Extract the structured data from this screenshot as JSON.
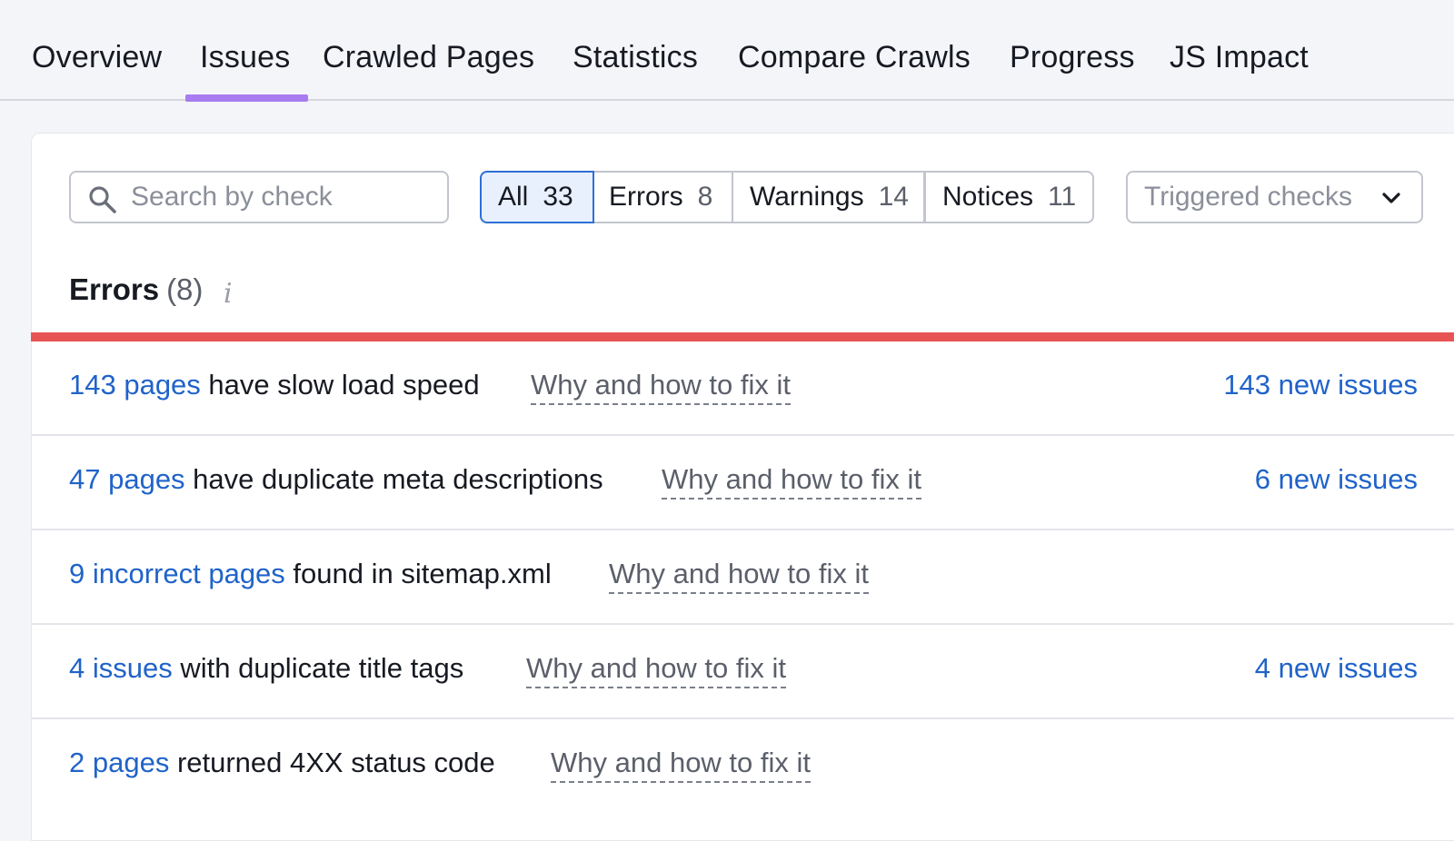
{
  "tabs": [
    {
      "label": "Overview"
    },
    {
      "label": "Issues"
    },
    {
      "label": "Crawled Pages"
    },
    {
      "label": "Statistics"
    },
    {
      "label": "Compare Crawls"
    },
    {
      "label": "Progress"
    },
    {
      "label": "JS Impact"
    }
  ],
  "active_tab": "Issues",
  "accent_color": "#a87cf0",
  "search": {
    "placeholder": "Search by check",
    "value": ""
  },
  "filters": [
    {
      "label": "All",
      "count": "33"
    },
    {
      "label": "Errors",
      "count": "8"
    },
    {
      "label": "Warnings",
      "count": "14"
    },
    {
      "label": "Notices",
      "count": "11"
    }
  ],
  "active_filter": "All",
  "triggered_select": {
    "label": "Triggered checks"
  },
  "section": {
    "title": "Errors",
    "count": "(8)",
    "color": "#e75454"
  },
  "issues": [
    {
      "link": "143 pages",
      "text": " have slow load speed",
      "fix": "Why and how to fix it",
      "new": "143 new issues"
    },
    {
      "link": "47 pages",
      "text": " have duplicate meta descriptions",
      "fix": "Why and how to fix it",
      "new": "6 new issues"
    },
    {
      "link": "9 incorrect pages",
      "text": " found in sitemap.xml",
      "fix": "Why and how to fix it",
      "new": ""
    },
    {
      "link": "4 issues",
      "text": " with duplicate title tags",
      "fix": "Why and how to fix it",
      "new": "4 new issues"
    },
    {
      "link": "2 pages",
      "text": " returned 4XX status code",
      "fix": "Why and how to fix it",
      "new": ""
    }
  ]
}
